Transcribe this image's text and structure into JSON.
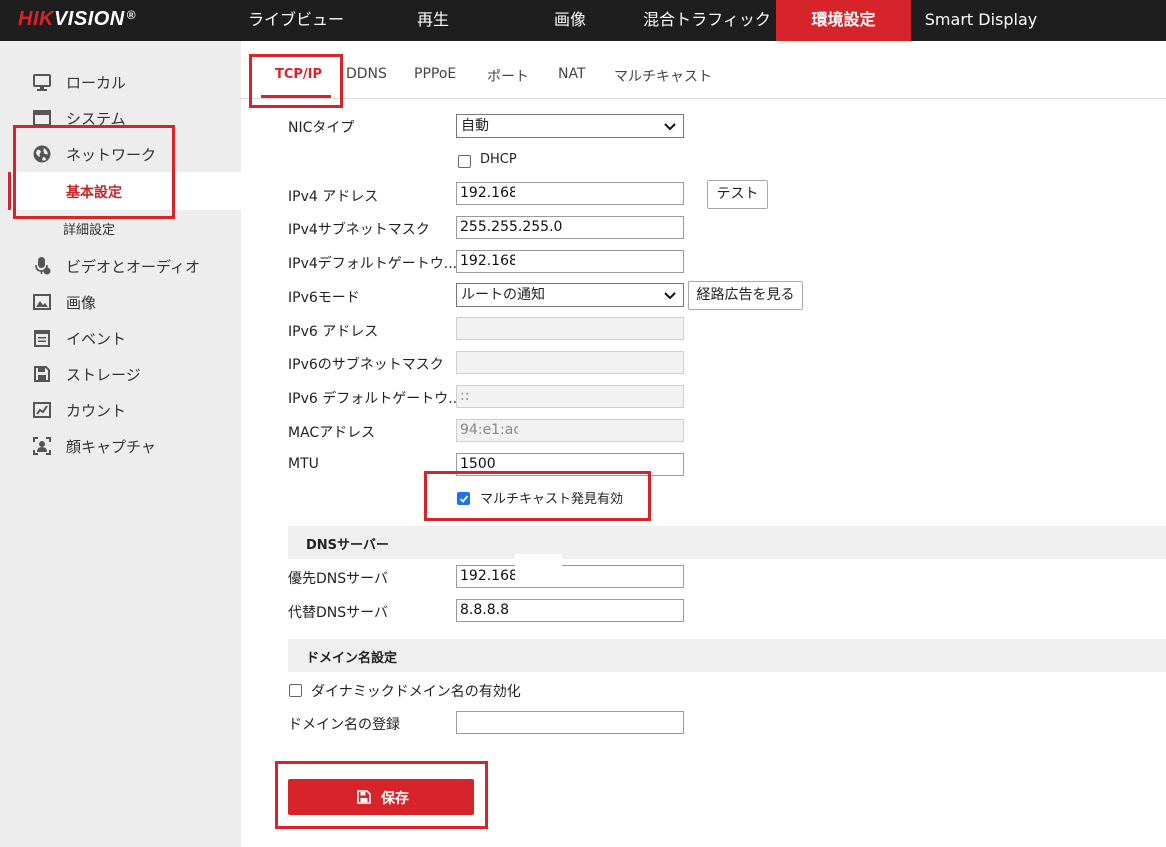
{
  "brand": {
    "hik": "HIK",
    "vision": "VISION",
    "reg": "®"
  },
  "topnav": [
    "ライブビュー",
    "再生",
    "画像",
    "混合トラフィック",
    "環境設定",
    "Smart Display"
  ],
  "sidebar": {
    "items": [
      {
        "label": "ローカル",
        "icon": "monitor-icon"
      },
      {
        "label": "システム",
        "icon": "system-window-icon"
      },
      {
        "label": "ネットワーク",
        "icon": "globe-icon"
      },
      {
        "label": "ビデオとオーディオ",
        "icon": "microphone-icon"
      },
      {
        "label": "画像",
        "icon": "image-icon"
      },
      {
        "label": "イベント",
        "icon": "calendar-icon"
      },
      {
        "label": "ストレージ",
        "icon": "floppy-disk-icon"
      },
      {
        "label": "カウント",
        "icon": "chart-icon"
      },
      {
        "label": "顔キャプチャ",
        "icon": "face-capture-icon"
      }
    ],
    "sub": [
      "基本設定",
      "詳細設定"
    ]
  },
  "tabs": [
    "TCP/IP",
    "DDNS",
    "PPPoE",
    "ポート",
    "NAT",
    "マルチキャスト"
  ],
  "form": {
    "nic_label": "NICタイプ",
    "nic_value": "自動",
    "dhcp_label": "DHCP",
    "ipv4_label": "IPv4 アドレス",
    "ipv4_value": "192.168",
    "test_button": "テスト",
    "mask_label": "IPv4サブネットマスク",
    "mask_value": "255.255.255.0",
    "gw_label": "IPv4デフォルトゲートウ...",
    "gw_value": "192.168",
    "ipv6mode_label": "IPv6モード",
    "ipv6mode_value": "ルートの通知",
    "route_button": "経路広告を見る",
    "ipv6_label": "IPv6 アドレス",
    "ipv6_value": "",
    "ipv6mask_label": "IPv6のサブネットマスク",
    "ipv6mask_value": "",
    "ipv6gw_label": "IPv6 デフォルトゲートウ...",
    "ipv6gw_value": "::",
    "mac_label": "MACアドレス",
    "mac_value": "94:e1:ac",
    "mtu_label": "MTU",
    "mtu_value": "1500",
    "multicast_label": "マルチキャスト発見有効"
  },
  "dns": {
    "title": "DNSサーバー",
    "pref_label": "優先DNSサーバ",
    "pref_value": "192.168",
    "alt_label": "代替DNSサーバ",
    "alt_value": "8.8.8.8"
  },
  "domain": {
    "title": "ドメイン名設定",
    "dyn_label": "ダイナミックドメイン名の有効化",
    "reg_label": "ドメイン名の登録",
    "reg_value": ""
  },
  "save_label": "保存",
  "colors": {
    "accent": "#d7242b",
    "topbar": "#1e1e1e",
    "sidebar": "#ededed",
    "checkbox": "#1a73e8"
  }
}
